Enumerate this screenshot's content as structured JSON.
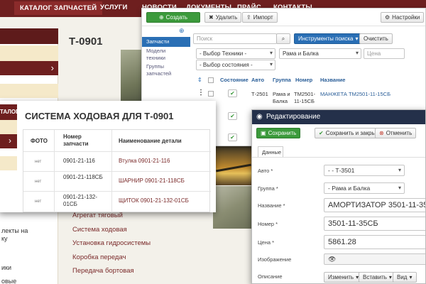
{
  "site": {
    "nav": [
      "КАТАЛОГ ЗАПЧАСТЕЙ",
      "УСЛУГИ",
      "НОВОСТИ",
      "ДОКУМЕНТЫ",
      "ПРАЙС",
      "КОНТАКТЫ"
    ],
    "page_title": "Т-0901",
    "left_menu": [
      "лекты на",
      "ку",
      "ики",
      "овые"
    ],
    "links": [
      "Агрегат тяговый",
      "Система ходовая",
      "Установка гидросистемы",
      "Коробка передач",
      "Передача бортовая"
    ]
  },
  "admin": {
    "toolbar": {
      "create": "Создать",
      "delete": "Удалить",
      "import": "Импорт",
      "settings": "Настройки"
    },
    "sidebar": {
      "items": [
        "Запчасти",
        "Модели техники",
        "Группы запчастей"
      ]
    },
    "filters": {
      "search_placeholder": "Поиск",
      "search_tools": "Инструменты поиска",
      "clear": "Очистить",
      "equipment": "- Выбор Техники -",
      "group": "Рама и Балка",
      "price_placeholder": "Цена",
      "state": "- Выбор состояния -"
    },
    "table": {
      "columns": [
        "Состояние",
        "Авто",
        "Группа",
        "Номер",
        "Название"
      ],
      "rows": [
        {
          "auto": "Т-2501",
          "group": "Рама и Балка",
          "number": "ТМ2501-11-15СБ",
          "name": "МАНЖЕТА ТМ2501-11-15СБ"
        }
      ]
    }
  },
  "catalog": {
    "side_label": "ТАЛОГ",
    "title": "СИСТЕМА ХОДОВАЯ ДЛЯ Т-0901",
    "columns": {
      "photo": "ФОТО",
      "number": "Номер запчасти",
      "name": "Наименование детали"
    },
    "rows": [
      {
        "photo": "нет",
        "number": "0901-21-116",
        "name": "Втулка 0901-21-116"
      },
      {
        "photo": "нет",
        "number": "0901-21-118СБ",
        "name": "ШАРНИР 0901-21-118СБ"
      },
      {
        "photo": "нет",
        "number": "0901-21-132-01СБ",
        "name": "ЩИТОК 0901-21-132-01СБ"
      }
    ]
  },
  "edit": {
    "title": "Редактирование",
    "save": "Сохранить",
    "save_close": "Сохранить и закрыть",
    "cancel": "Отменить",
    "tab_data": "Данные",
    "fields": {
      "auto": {
        "label": "Авто *",
        "value": "- - Т-3501"
      },
      "group": {
        "label": "Группа *",
        "value": "- Рама и Балка"
      },
      "name": {
        "label": "Название *",
        "value": "АМОРТИЗАТОР 3501-11-35СБ"
      },
      "number": {
        "label": "Номер *",
        "value": "3501-11-35СБ"
      },
      "price": {
        "label": "Цена *",
        "value": "5861.28"
      },
      "image": {
        "label": "Изображение"
      },
      "description": {
        "label": "Описание"
      }
    },
    "editor": {
      "change": "Изменить",
      "insert": "Вставить",
      "view": "Вид"
    }
  },
  "colors": {
    "brand": "#6e1f1f",
    "primary": "#2a6fb5",
    "success": "#3c9a3c",
    "dialog_header": "#24304a"
  }
}
